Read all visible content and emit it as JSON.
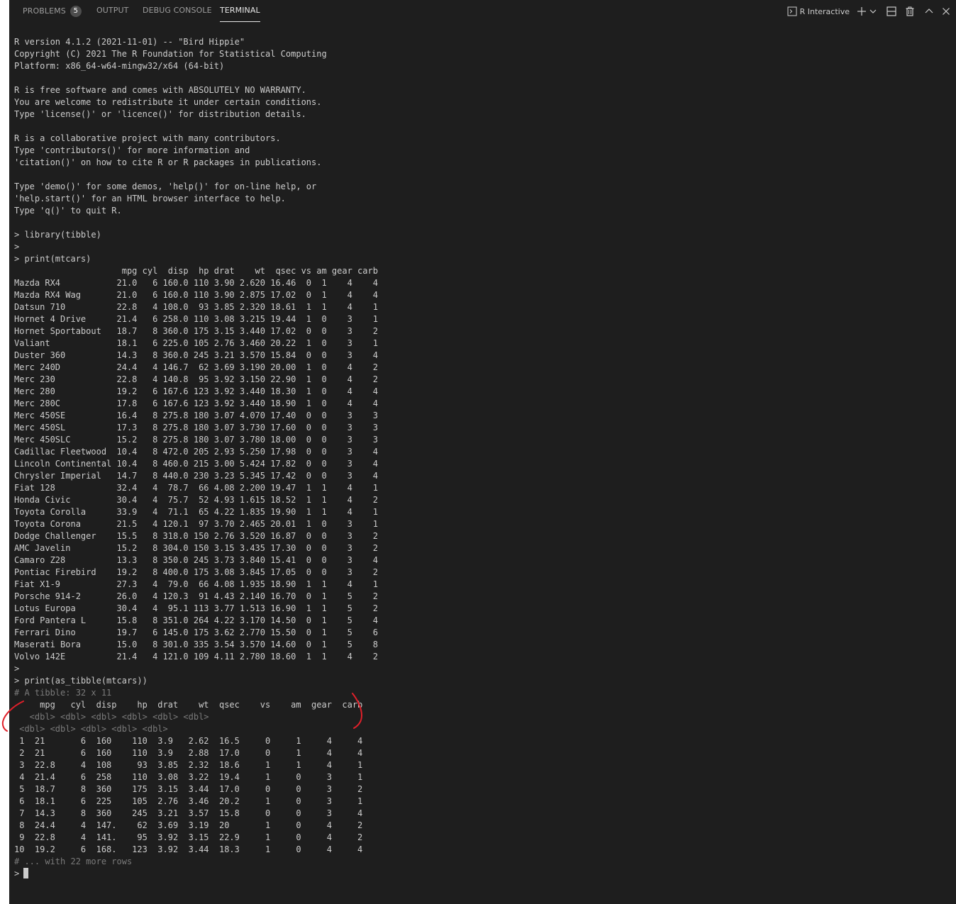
{
  "tabs": [
    {
      "label": "PROBLEMS",
      "badge": "5"
    },
    {
      "label": "OUTPUT"
    },
    {
      "label": "DEBUG CONSOLE"
    },
    {
      "label": "TERMINAL"
    }
  ],
  "active_tab": "TERMINAL",
  "toolbar": {
    "terminal_name": "R Interactive",
    "icons": [
      "terminal-icon",
      "plus-icon",
      "chevron-down-icon",
      "split-icon",
      "trash-icon",
      "chevron-up-icon",
      "close-icon"
    ]
  },
  "colors": {
    "panel_bg": "#1e1e1e",
    "text": "#cccccc",
    "dim_text": "#7a7a7a",
    "annotation": "#e0202a"
  },
  "terminal": {
    "lines": [
      "R version 4.1.2 (2021-11-01) -- \"Bird Hippie\"",
      "Copyright (C) 2021 The R Foundation for Statistical Computing",
      "Platform: x86_64-w64-mingw32/x64 (64-bit)",
      "",
      "R is free software and comes with ABSOLUTELY NO WARRANTY.",
      "You are welcome to redistribute it under certain conditions.",
      "Type 'license()' or 'licence()' for distribution details.",
      "",
      "R is a collaborative project with many contributors.",
      "Type 'contributors()' for more information and",
      "'citation()' on how to cite R or R packages in publications.",
      "",
      "Type 'demo()' for some demos, 'help()' for on-line help, or",
      "'help.start()' for an HTML browser interface to help.",
      "Type 'q()' to quit R.",
      "",
      "> library(tibble)",
      ">",
      "> print(mtcars)",
      "                     mpg cyl  disp  hp drat    wt  qsec vs am gear carb",
      "Mazda RX4           21.0   6 160.0 110 3.90 2.620 16.46  0  1    4    4",
      "Mazda RX4 Wag       21.0   6 160.0 110 3.90 2.875 17.02  0  1    4    4",
      "Datsun 710          22.8   4 108.0  93 3.85 2.320 18.61  1  1    4    1",
      "Hornet 4 Drive      21.4   6 258.0 110 3.08 3.215 19.44  1  0    3    1",
      "Hornet Sportabout   18.7   8 360.0 175 3.15 3.440 17.02  0  0    3    2",
      "Valiant             18.1   6 225.0 105 2.76 3.460 20.22  1  0    3    1",
      "Duster 360          14.3   8 360.0 245 3.21 3.570 15.84  0  0    3    4",
      "Merc 240D           24.4   4 146.7  62 3.69 3.190 20.00  1  0    4    2",
      "Merc 230            22.8   4 140.8  95 3.92 3.150 22.90  1  0    4    2",
      "Merc 280            19.2   6 167.6 123 3.92 3.440 18.30  1  0    4    4",
      "Merc 280C           17.8   6 167.6 123 3.92 3.440 18.90  1  0    4    4",
      "Merc 450SE          16.4   8 275.8 180 3.07 4.070 17.40  0  0    3    3",
      "Merc 450SL          17.3   8 275.8 180 3.07 3.730 17.60  0  0    3    3",
      "Merc 450SLC         15.2   8 275.8 180 3.07 3.780 18.00  0  0    3    3",
      "Cadillac Fleetwood  10.4   8 472.0 205 2.93 5.250 17.98  0  0    3    4",
      "Lincoln Continental 10.4   8 460.0 215 3.00 5.424 17.82  0  0    3    4",
      "Chrysler Imperial   14.7   8 440.0 230 3.23 5.345 17.42  0  0    3    4",
      "Fiat 128            32.4   4  78.7  66 4.08 2.200 19.47  1  1    4    1",
      "Honda Civic         30.4   4  75.7  52 4.93 1.615 18.52  1  1    4    2",
      "Toyota Corolla      33.9   4  71.1  65 4.22 1.835 19.90  1  1    4    1",
      "Toyota Corona       21.5   4 120.1  97 3.70 2.465 20.01  1  0    3    1",
      "Dodge Challenger    15.5   8 318.0 150 2.76 3.520 16.87  0  0    3    2",
      "AMC Javelin         15.2   8 304.0 150 3.15 3.435 17.30  0  0    3    2",
      "Camaro Z28          13.3   8 350.0 245 3.73 3.840 15.41  0  0    3    4",
      "Pontiac Firebird    19.2   8 400.0 175 3.08 3.845 17.05  0  0    3    2",
      "Fiat X1-9           27.3   4  79.0  66 4.08 1.935 18.90  1  1    4    1",
      "Porsche 914-2       26.0   4 120.3  91 4.43 2.140 16.70  0  1    5    2",
      "Lotus Europa        30.4   4  95.1 113 3.77 1.513 16.90  1  1    5    2",
      "Ford Pantera L      15.8   8 351.0 264 4.22 3.170 14.50  0  1    5    4",
      "Ferrari Dino        19.7   6 145.0 175 3.62 2.770 15.50  0  1    5    6",
      "Maserati Bora       15.0   8 301.0 335 3.54 3.570 14.60  0  1    5    8",
      "Volvo 142E          21.4   4 121.0 109 4.11 2.780 18.60  1  1    4    2",
      ">",
      "> print(as_tibble(mtcars))",
      {
        "text": "# A tibble: 32 x 11",
        "dim": true
      },
      "     mpg   cyl  disp    hp  drat    wt  qsec    vs    am  gear  carb",
      {
        "text": "   <dbl> <dbl> <dbl> <dbl> <dbl> <dbl>",
        "dim": true
      },
      {
        "text": " <dbl> <dbl> <dbl> <dbl> <dbl>",
        "dim": true
      },
      " 1  21       6  160    110  3.9   2.62  16.5     0     1     4     4",
      " 2  21       6  160    110  3.9   2.88  17.0     0     1     4     4",
      " 3  22.8     4  108     93  3.85  2.32  18.6     1     1     4     1",
      " 4  21.4     6  258    110  3.08  3.22  19.4     1     0     3     1",
      " 5  18.7     8  360    175  3.15  3.44  17.0     0     0     3     2",
      " 6  18.1     6  225    105  2.76  3.46  20.2     1     0     3     1",
      " 7  14.3     8  360    245  3.21  3.57  15.8     0     0     3     4",
      " 8  24.4     4  147.    62  3.69  3.19  20       1     0     4     2",
      " 9  22.8     4  141.    95  3.92  3.15  22.9     1     0     4     2",
      "10  19.2     6  168.   123  3.92  3.44  18.3     1     0     4     4",
      {
        "text": "# ... with 22 more rows",
        "dim": true
      }
    ],
    "prompt": ">"
  }
}
